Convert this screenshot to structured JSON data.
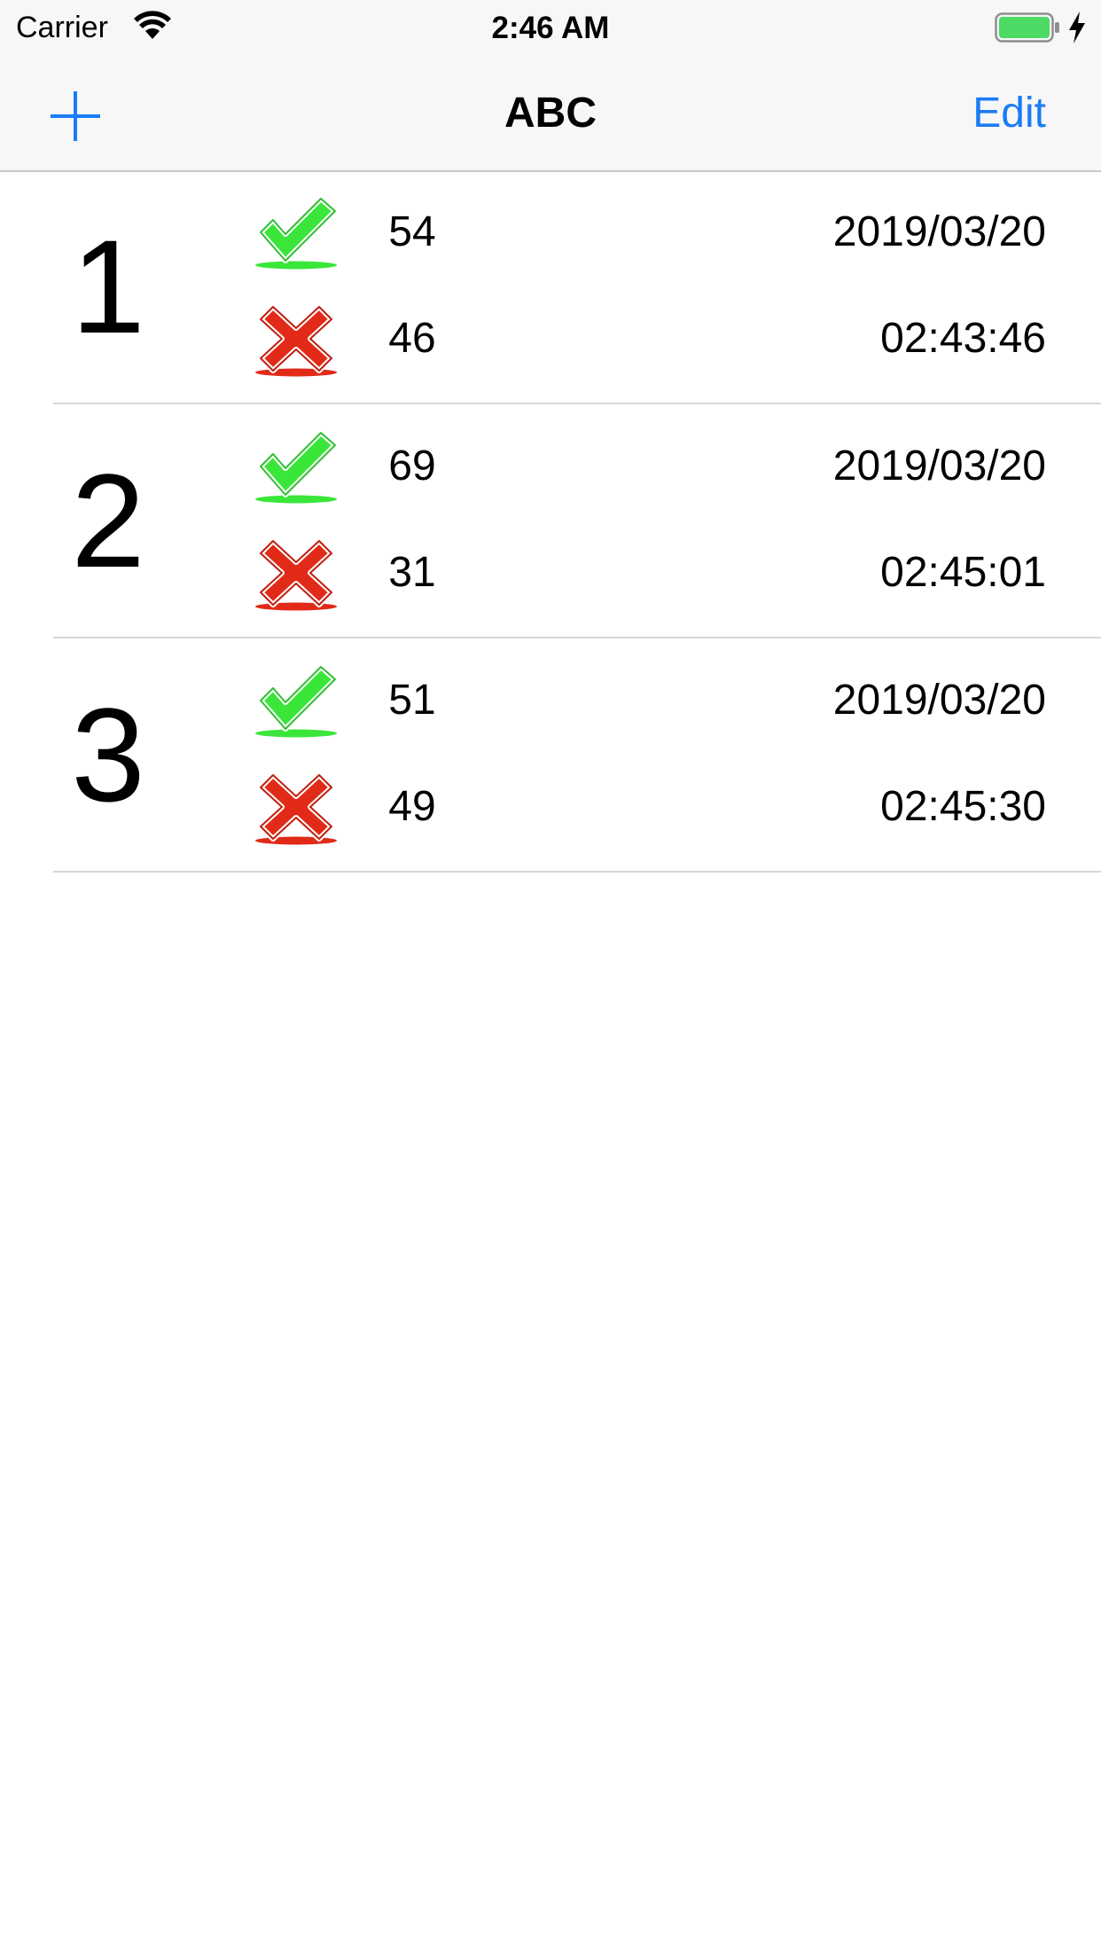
{
  "status_bar": {
    "carrier": "Carrier",
    "time": "2:46 AM",
    "battery_color": "#4cd964"
  },
  "nav_bar": {
    "title": "ABC",
    "add_icon": "plus-icon",
    "edit_label": "Edit",
    "accent_color": "#1a7cf5"
  },
  "rows": [
    {
      "index": "1",
      "correct": "54",
      "wrong": "46",
      "date": "2019/03/20",
      "time": "02:43:46"
    },
    {
      "index": "2",
      "correct": "69",
      "wrong": "31",
      "date": "2019/03/20",
      "time": "02:45:01"
    },
    {
      "index": "3",
      "correct": "51",
      "wrong": "49",
      "date": "2019/03/20",
      "time": "02:45:30"
    }
  ],
  "icons": {
    "correct": "green-check-icon",
    "wrong": "red-cross-icon",
    "correct_color": "#3ae63a",
    "wrong_color": "#e12a17"
  }
}
